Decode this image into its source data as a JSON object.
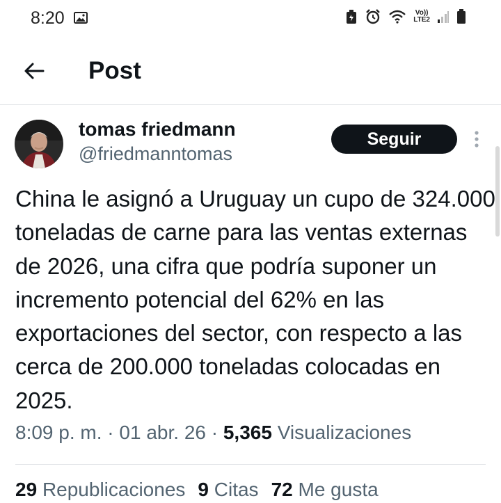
{
  "status_bar": {
    "time": "8:20",
    "network_top": "Vo))",
    "network_bottom": "LTE2"
  },
  "header": {
    "title": "Post",
    "back_icon": "arrow-left-icon"
  },
  "post": {
    "author_name": "tomas friedmann",
    "author_handle": "@friedmanntomas",
    "follow_label": "Seguir",
    "text": "China le asignó a Uruguay un cupo de 324.000 toneladas de carne para las ventas externas de 2026, una cifra que podría suponer un incremento potencial del 62% en las exportaciones del sector, con respecto a las cerca de 200.000 toneladas colocadas en 2025.",
    "time": "8:09 p. m.",
    "date": "01 abr. 26",
    "views_count": "5,365",
    "views_label": "Visualizaciones"
  },
  "stats": {
    "reposts_count": "29",
    "reposts_label": "Republicaciones",
    "quotes_count": "9",
    "quotes_label": "Citas",
    "likes_count": "72",
    "likes_label": "Me gusta"
  },
  "colors": {
    "text_primary": "#0f1419",
    "text_secondary": "#536471",
    "follow_bg": "#0f1419",
    "divider": "#e1e4e7"
  }
}
